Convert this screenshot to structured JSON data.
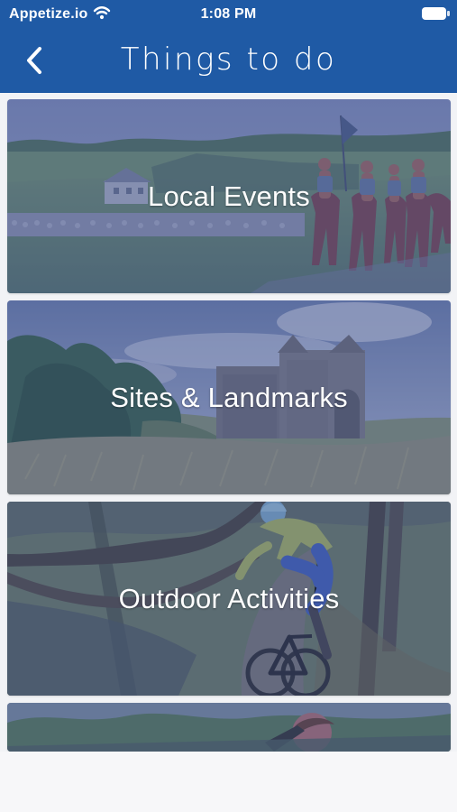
{
  "status_bar": {
    "carrier": "Appetize.io",
    "time": "1:08 PM",
    "wifi_icon": "wifi-icon",
    "battery_icon": "battery-icon"
  },
  "navigation": {
    "title": "Things to do",
    "back_icon": "chevron-left-icon"
  },
  "cards": [
    {
      "label": "Local Events",
      "image_subject": "riders on horseback on a grassy field"
    },
    {
      "label": "Sites & Landmarks",
      "image_subject": "stone castle on moorland"
    },
    {
      "label": "Outdoor Activities",
      "image_subject": "mountain biker on woodland trail"
    },
    {
      "label": "",
      "image_subject": "person outdoors in green landscape"
    }
  ],
  "colors": {
    "header": "#1f5aa5",
    "overlay": "#4d5f9a",
    "background": "#f2f3f6",
    "text": "#ffffff"
  }
}
